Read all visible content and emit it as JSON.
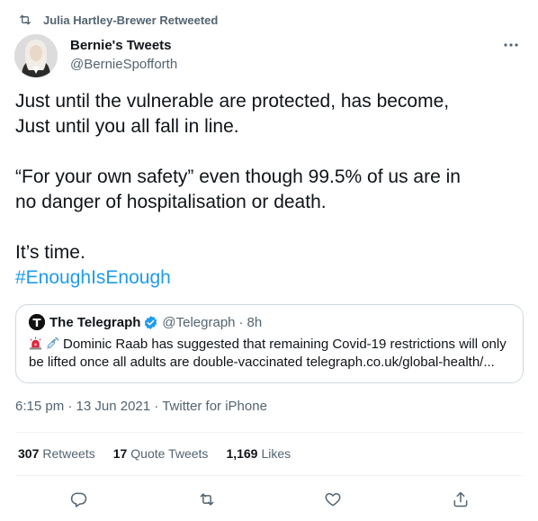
{
  "retweet_notice": {
    "text": "Julia Hartley-Brewer Retweeted",
    "icon": "retweet-icon"
  },
  "author": {
    "display_name": "Bernie's Tweets",
    "handle": "@BernieSpofforth",
    "more_icon": "more-horizontal-icon"
  },
  "tweet": {
    "line1": "Just until the vulnerable are protected, has become,",
    "line2": "Just until you all fall in line.",
    "line3": "“For your own safety” even though 99.5% of us are in",
    "line4": "no danger of hospitalisation or death.",
    "line5": "It’s time.",
    "hashtag": "#EnoughIsEnough"
  },
  "quote": {
    "name": "The Telegraph",
    "handle": "@Telegraph",
    "separator": "·",
    "time": "8h",
    "verified_icon": "verified-badge-icon",
    "emojis": [
      "siren-emoji",
      "syringe-emoji"
    ],
    "line1": "Dominic Raab has suggested that remaining Covid-19 restrictions will only",
    "line2": "be lifted once all adults are double-vaccinated telegraph.co.uk/global-health/..."
  },
  "meta": {
    "time": "6:15 pm",
    "date": "13 Jun 2021",
    "source": "Twitter for iPhone",
    "separator": "·"
  },
  "stats": {
    "retweets_count": "307",
    "retweets_label": "Retweets",
    "quotes_count": "17",
    "quotes_label": "Quote Tweets",
    "likes_count": "1,169",
    "likes_label": "Likes"
  },
  "actions": [
    "reply-icon",
    "retweet-icon",
    "like-icon",
    "share-icon"
  ],
  "colors": {
    "accent": "#1d9bf0",
    "secondary_text": "#536471",
    "text": "#0f1419",
    "border": "#cfd9de"
  }
}
